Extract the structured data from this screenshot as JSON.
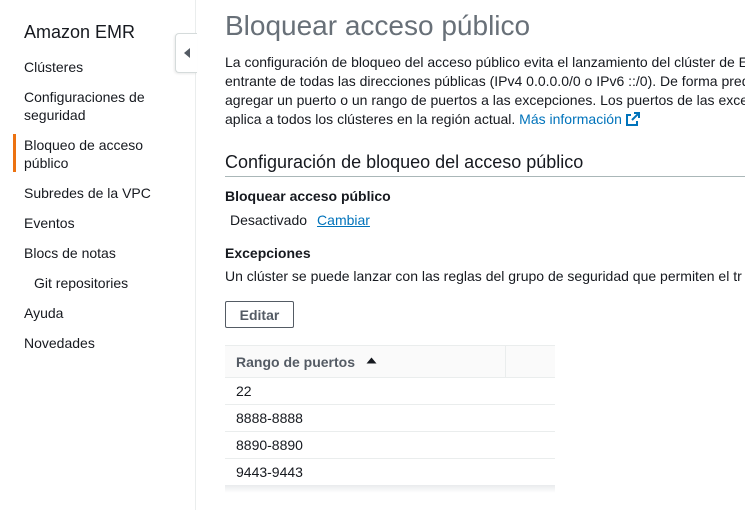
{
  "sidebar": {
    "title": "Amazon EMR",
    "items": [
      {
        "label": "Clústeres"
      },
      {
        "label": "Configuraciones de seguridad"
      },
      {
        "label": "Bloqueo de acceso público",
        "active": true
      },
      {
        "label": "Subredes de la VPC"
      },
      {
        "label": "Eventos"
      },
      {
        "label": "Blocs de notas"
      },
      {
        "label": "Git repositories",
        "sub": true
      },
      {
        "label": "Ayuda"
      },
      {
        "label": "Novedades"
      }
    ],
    "active_color": "#ec7211"
  },
  "main": {
    "title": "Bloquear acceso público",
    "intro_lines": [
      "La configuración de bloqueo del acceso público evita el lanzamiento del clúster de E",
      "entrante de todas las direcciones públicas (IPv4 0.0.0.0/0 o IPv6 ::/0). De forma pred",
      "agregar un puerto o un rango de puertos a las excepciones. Los puertos de las excep",
      "aplica a todos los clústeres en la región actual."
    ],
    "more_info_link": "Más información",
    "section_title": "Configuración de bloqueo del acceso público",
    "block_label": "Bloquear acceso público",
    "block_status": "Desactivado",
    "change_link": "Cambiar",
    "exceptions_label": "Excepciones",
    "exceptions_desc": "Un clúster se puede lanzar con las reglas del grupo de seguridad que permiten el tr",
    "edit_button": "Editar",
    "table": {
      "column": "Rango de puertos",
      "sort": "ascending",
      "rows": [
        "22",
        "8888-8888",
        "8890-8890",
        "9443-9443"
      ]
    }
  },
  "colors": {
    "link": "#0073bb",
    "title": "#687078",
    "accent": "#ec7211"
  }
}
